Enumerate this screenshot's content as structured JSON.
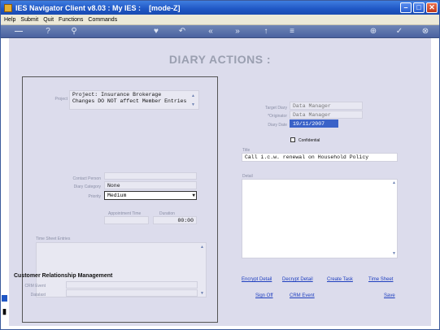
{
  "window": {
    "title": "IES Navigator Client v8.03 : My IES :",
    "mode": "[mode-Z]"
  },
  "menu": [
    "Help",
    "Submit",
    "Quit",
    "Functions",
    "Commands"
  ],
  "page": {
    "heading": "DIARY ACTIONS :"
  },
  "left": {
    "project_label": "Project",
    "project_line1": "Project: Insurance Brokerage",
    "project_line2": "Changes DO NOT affect Member Entries",
    "contact_person_label": "Contact Person",
    "diary_category_label": "Diary Category",
    "diary_category_value": "None",
    "priority_label": "Priority",
    "priority_value": "Medium",
    "appointment_time_label": "Appointment Time",
    "duration_label": "Duration",
    "duration_value": "00:00",
    "time_sheet_label": "Time Sheet Entries"
  },
  "crm": {
    "title": "Customer Relationship Management",
    "crm_event_label": "CRM Event",
    "datalast_label": "Datalast"
  },
  "right": {
    "target_diary_label": "Target Diary",
    "target_diary_value": "Data Manager",
    "originator_label": "*Originator",
    "originator_value": "Data Manager",
    "diary_date_label": "Diary Date",
    "diary_date_value": "19/11/2007",
    "confidential_label": "Confidential",
    "title_label": "Title",
    "title_value": "Call i.c.w. renewal on Household Policy",
    "detail_label": "Detail"
  },
  "links": {
    "encrypt": "Encrypt Detail",
    "decrypt": "Decrypt Detail",
    "create_task": "Create Task",
    "time_sheet": "Time Sheet",
    "sign_off": "Sign Off",
    "crm_event": "CRM Event",
    "save": "Save"
  },
  "colors": {
    "title_bar": "#1f56c4",
    "link": "#1f3fbf",
    "date_highlight": "#3a62c8"
  }
}
